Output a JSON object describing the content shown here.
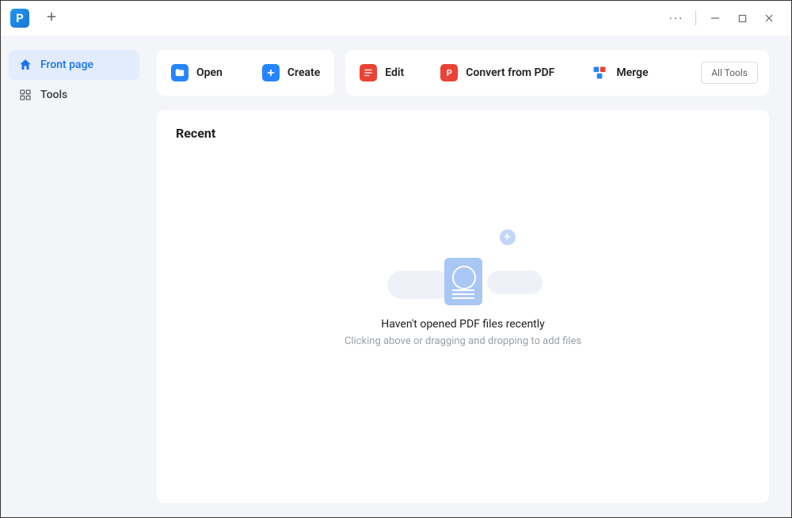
{
  "titlebar": {
    "app_logo_initial": "P"
  },
  "sidebar": {
    "items": [
      {
        "label": "Front page"
      },
      {
        "label": "Tools"
      }
    ]
  },
  "toolbar": {
    "open_label": "Open",
    "create_label": "Create",
    "edit_label": "Edit",
    "convert_label": "Convert from PDF",
    "merge_label": "Merge",
    "all_tools_label": "All Tools"
  },
  "recent": {
    "heading": "Recent",
    "empty_title": "Haven't opened PDF files recently",
    "empty_subtitle": "Clicking above or dragging and dropping to add files"
  }
}
